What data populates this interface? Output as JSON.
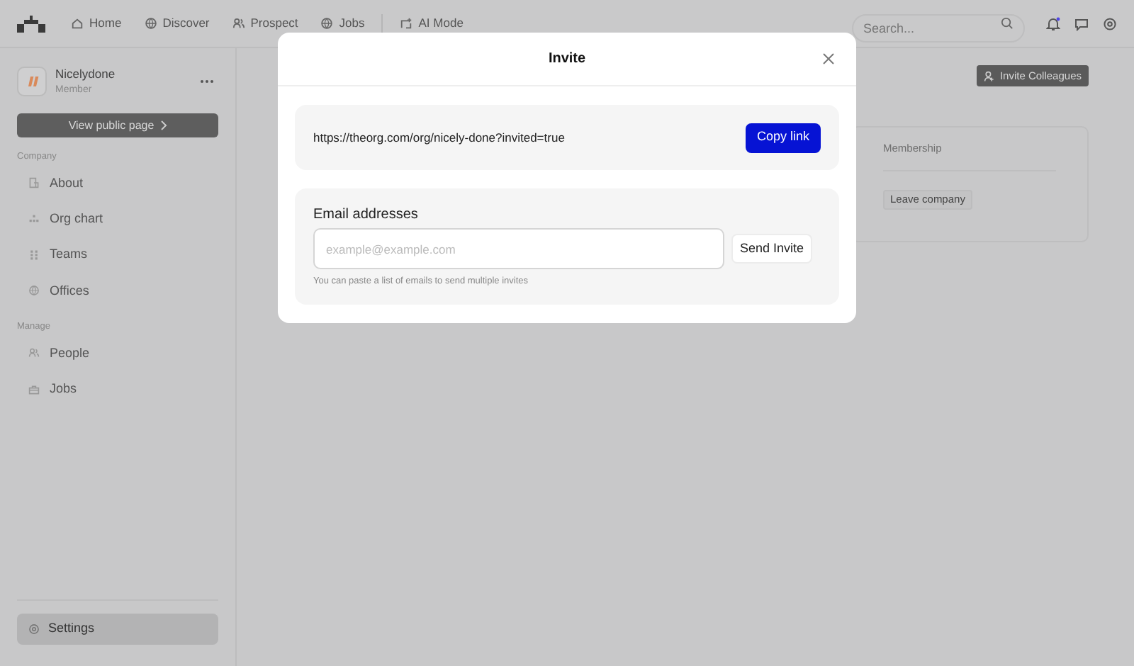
{
  "nav": {
    "items": [
      {
        "label": "Home"
      },
      {
        "label": "Discover"
      },
      {
        "label": "Prospect"
      },
      {
        "label": "Jobs"
      },
      {
        "label": "AI Mode"
      }
    ],
    "search": {
      "placeholder": "Search..."
    }
  },
  "sidebar": {
    "org": {
      "name": "Nicelydone",
      "role": "Member"
    },
    "view_button": "View public page",
    "sections": [
      {
        "title": "Company",
        "items": [
          {
            "label": "About",
            "selected": false
          },
          {
            "label": "Org chart",
            "selected": false
          },
          {
            "label": "Teams",
            "selected": false
          },
          {
            "label": "Offices",
            "selected": false
          }
        ]
      },
      {
        "title": "Manage",
        "items": [
          {
            "label": "People",
            "selected": false
          },
          {
            "label": "Jobs",
            "selected": false
          }
        ]
      }
    ],
    "settings": {
      "label": "Settings",
      "selected": true
    }
  },
  "main": {
    "invite_button": "Invite Colleagues",
    "table": {
      "columns": [
        "Membership"
      ],
      "rows": [
        {
          "action": "Leave company"
        }
      ]
    }
  },
  "modal": {
    "title": "Invite",
    "link": "https://theorg.com/org/nicely-done?invited=true",
    "copy_button": "Copy link",
    "email": {
      "label": "Email addresses",
      "placeholder": "example@example.com",
      "send_button": "Send Invite",
      "hint": "You can paste a list of emails to send multiple invites"
    }
  }
}
